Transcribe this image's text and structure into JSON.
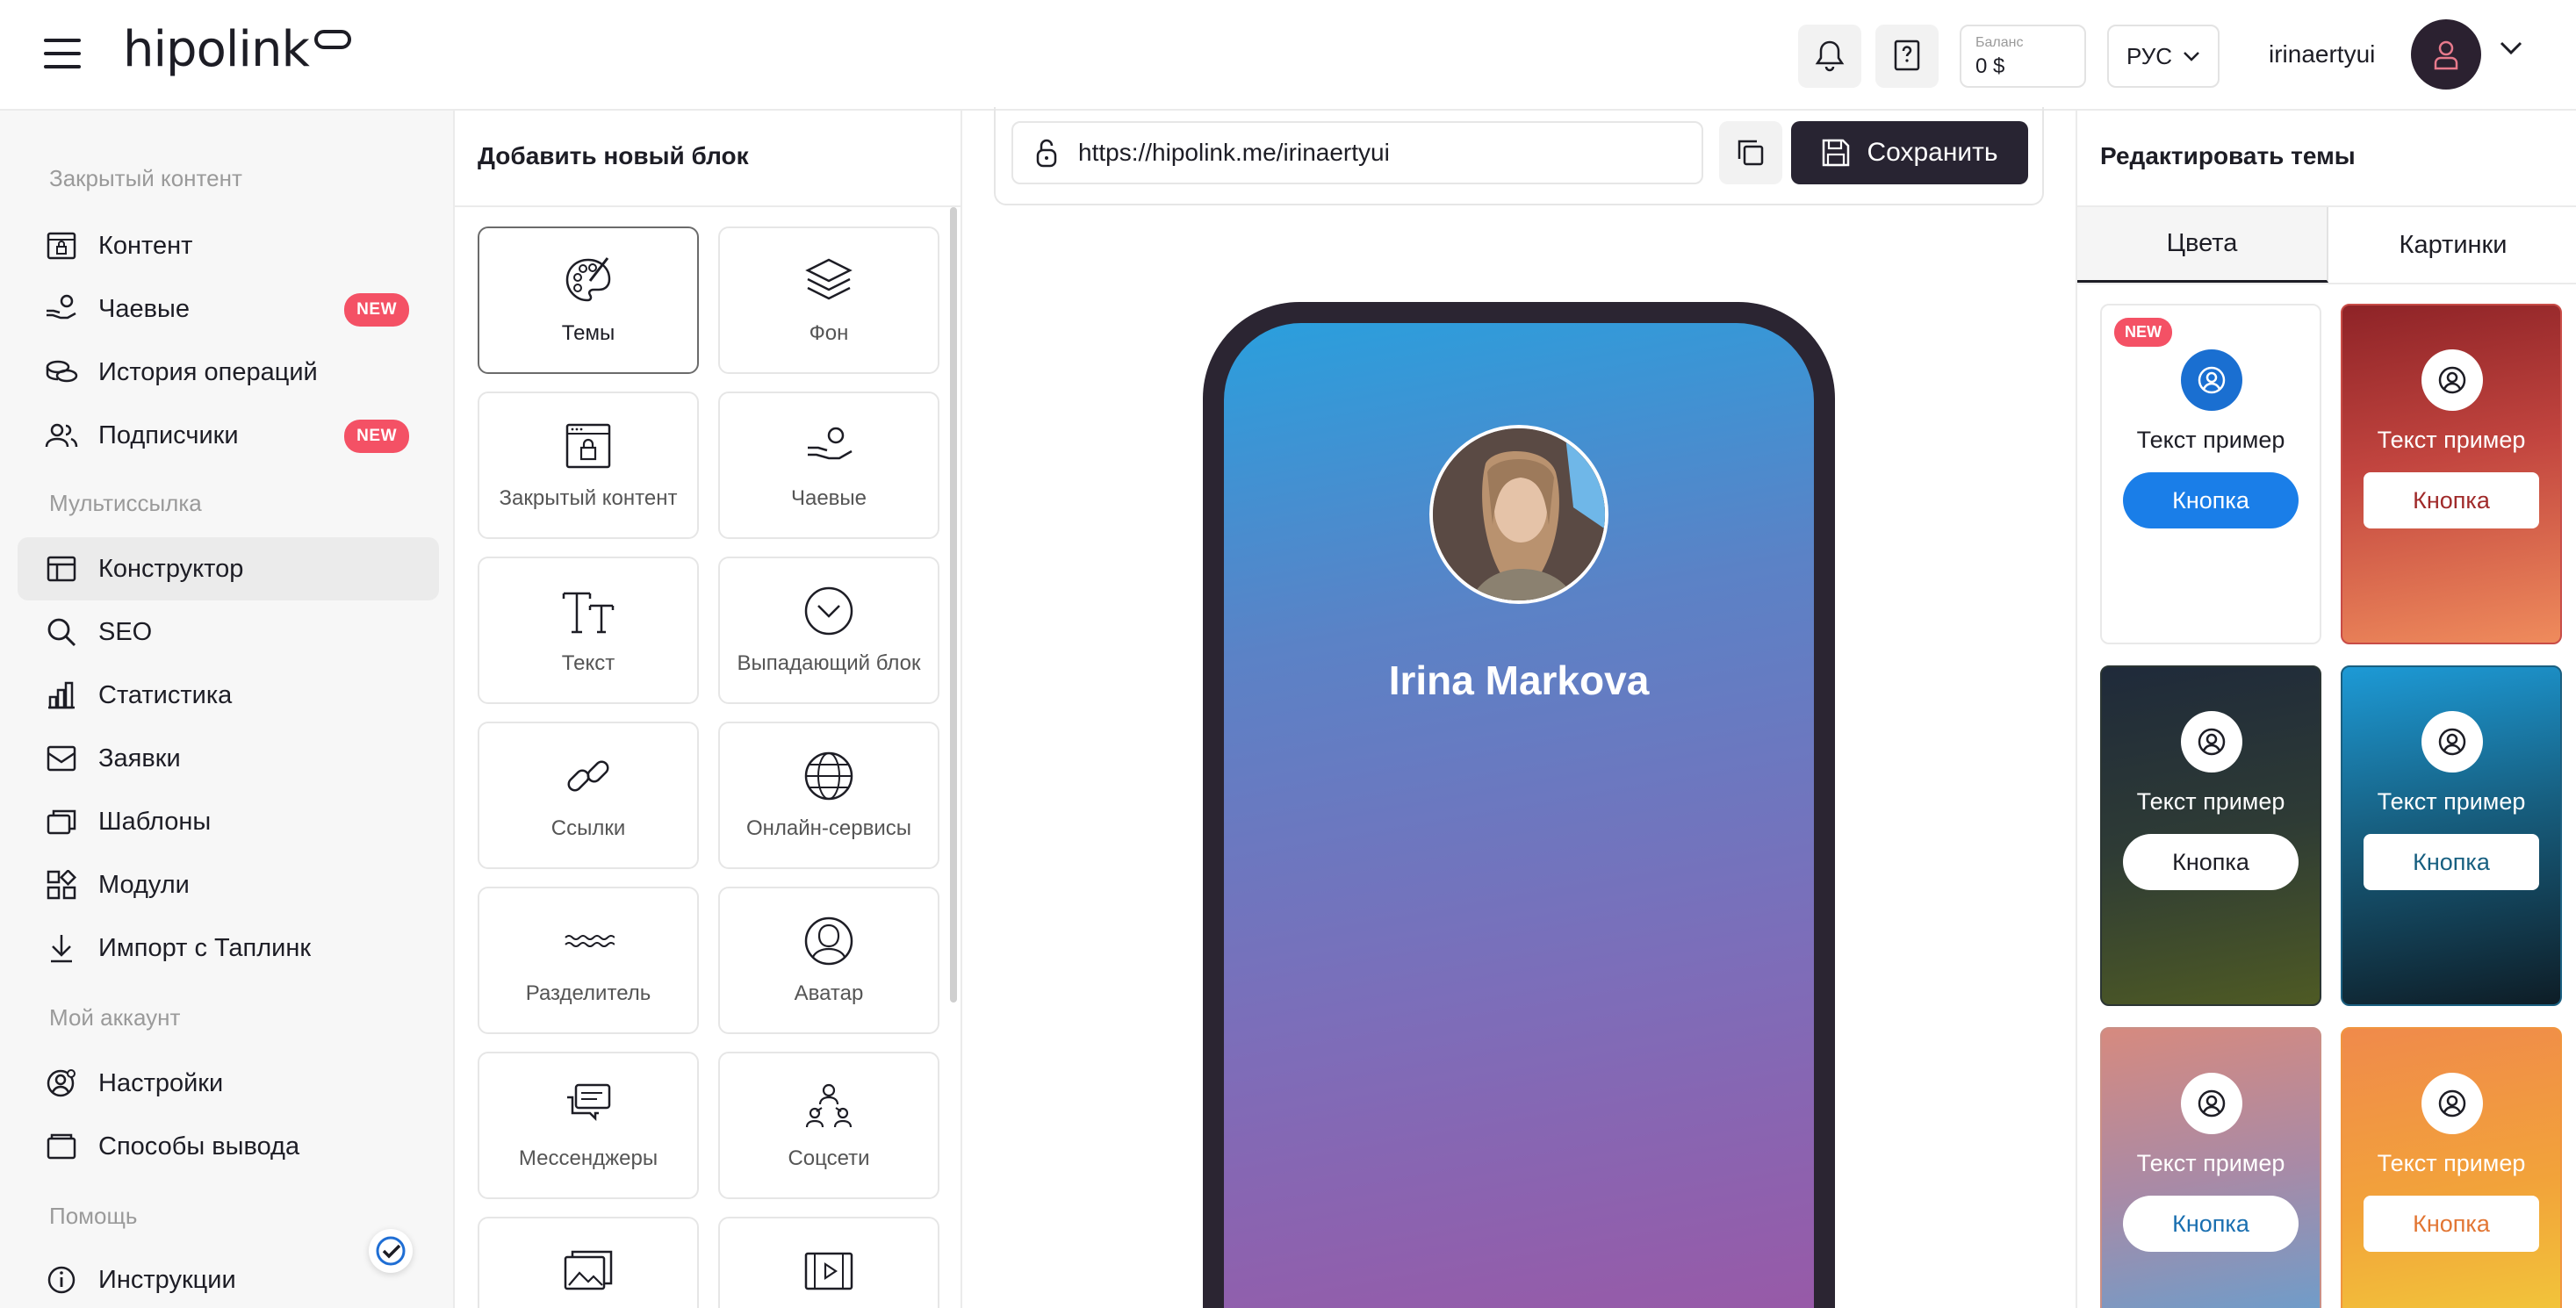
{
  "header": {
    "logo": "hipolink",
    "balance_label": "Баланс",
    "balance_value": "0 $",
    "language": "РУС",
    "username": "irinaertyui"
  },
  "sidebar": {
    "sections": [
      {
        "title": "Закрытый контент"
      },
      {
        "title": "Мультиссылка"
      },
      {
        "title": "Мой аккаунт"
      },
      {
        "title": "Помощь"
      }
    ],
    "items": [
      {
        "label": "Контент",
        "icon": "lock-window-icon"
      },
      {
        "label": "Чаевые",
        "icon": "tips-hand-icon",
        "badge": "NEW"
      },
      {
        "label": "История операций",
        "icon": "coins-icon"
      },
      {
        "label": "Подписчики",
        "icon": "users-icon",
        "badge": "NEW"
      },
      {
        "label": "Конструктор",
        "icon": "layout-icon",
        "active": true
      },
      {
        "label": "SEO",
        "icon": "search-icon"
      },
      {
        "label": "Статистика",
        "icon": "bar-chart-icon"
      },
      {
        "label": "Заявки",
        "icon": "inbox-icon"
      },
      {
        "label": "Шаблоны",
        "icon": "templates-icon"
      },
      {
        "label": "Модули",
        "icon": "modules-icon"
      },
      {
        "label": "Импорт с Таплинк",
        "icon": "download-icon"
      },
      {
        "label": "Настройки",
        "icon": "user-settings-icon"
      },
      {
        "label": "Способы вывода",
        "icon": "wallet-icon"
      },
      {
        "label": "Инструкции",
        "icon": "info-icon"
      }
    ]
  },
  "blocks_panel": {
    "title": "Добавить новый блок",
    "tiles": [
      {
        "label": "Темы",
        "icon": "palette-icon",
        "selected": true
      },
      {
        "label": "Фон",
        "icon": "layers-icon"
      },
      {
        "label": "Закрытый контент",
        "icon": "lock-window-icon"
      },
      {
        "label": "Чаевые",
        "icon": "tips-hand-icon"
      },
      {
        "label": "Текст",
        "icon": "text-icon"
      },
      {
        "label": "Выпадающий блок",
        "icon": "chevron-circle-icon"
      },
      {
        "label": "Ссылки",
        "icon": "link-icon"
      },
      {
        "label": "Онлайн-сервисы",
        "icon": "globe-icon"
      },
      {
        "label": "Разделитель",
        "icon": "wave-divider-icon"
      },
      {
        "label": "Аватар",
        "icon": "avatar-icon"
      },
      {
        "label": "Мессенджеры",
        "icon": "chat-icon"
      },
      {
        "label": "Соцсети",
        "icon": "social-people-icon"
      },
      {
        "label": "",
        "icon": "gallery-icon"
      },
      {
        "label": "",
        "icon": "video-icon"
      }
    ]
  },
  "preview": {
    "url": "https://hipolink.me/irinaertyui",
    "save_label": "Сохранить",
    "profile_name": "Irina Markova"
  },
  "themes_panel": {
    "title": "Редактировать темы",
    "tabs": [
      "Цвета",
      "Картинки"
    ],
    "sample_text": "Текст пример",
    "button_text": "Кнопка",
    "new_badge": "NEW"
  }
}
